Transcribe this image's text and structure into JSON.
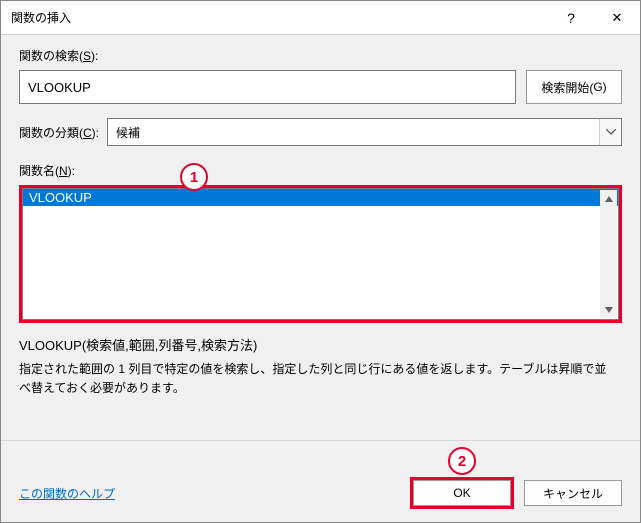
{
  "title": "関数の挿入",
  "search": {
    "label_pre": "関数の検索(",
    "label_key": "S",
    "label_post": "):",
    "value": "VLOOKUP",
    "go_label_pre": "検索開始(",
    "go_label_key": "G",
    "go_label_post": ")"
  },
  "category": {
    "label_pre": "関数の分類(",
    "label_key": "C",
    "label_post": "):",
    "value": "候補"
  },
  "funcname": {
    "label_pre": "関数名(",
    "label_key": "N",
    "label_post": "):",
    "selected": "VLOOKUP"
  },
  "syntax": "VLOOKUP(検索値,範囲,列番号,検索方法)",
  "description": "指定された範囲の 1 列目で特定の値を検索し、指定した列と同じ行にある値を返します。テーブルは昇順で並べ替えておく必要があります。",
  "help_link": "この関数のヘルプ",
  "ok_label": "OK",
  "cancel_label": "キャンセル",
  "annotations": {
    "a1": "1",
    "a2": "2"
  },
  "titlebar": {
    "help": "?",
    "close": "✕"
  }
}
